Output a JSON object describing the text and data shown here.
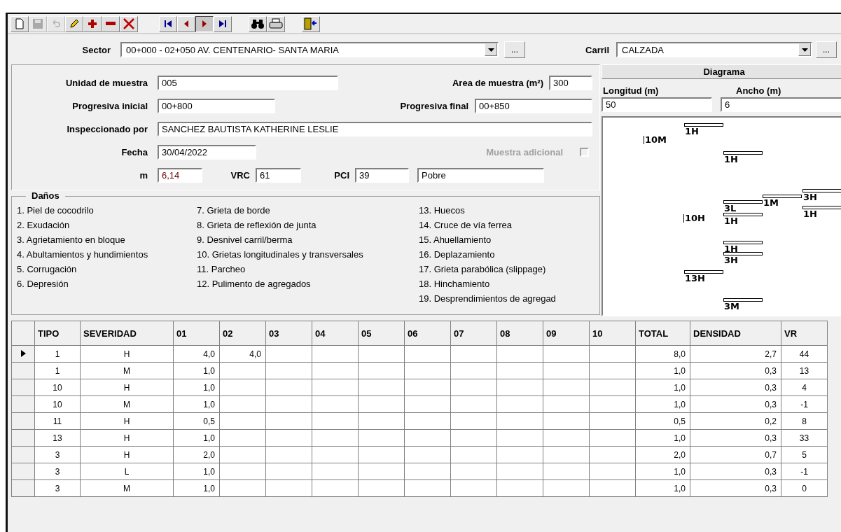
{
  "toolbar": [
    {
      "disabled": false,
      "pressed": false
    },
    {
      "disabled": true,
      "pressed": false
    },
    {
      "disabled": true,
      "pressed": false
    },
    {
      "disabled": false,
      "pressed": false
    },
    {
      "disabled": false,
      "pressed": false
    },
    {
      "disabled": false,
      "pressed": false
    },
    {
      "disabled": false,
      "pressed": false
    },
    {
      "disabled": false,
      "pressed": false
    },
    {
      "disabled": false,
      "pressed": false
    },
    {
      "disabled": false,
      "pressed": true
    },
    {
      "disabled": false,
      "pressed": false
    },
    {
      "disabled": false,
      "pressed": false
    },
    {
      "disabled": false,
      "pressed": false
    },
    {
      "disabled": false,
      "pressed": false
    }
  ],
  "sector": {
    "label": "Sector",
    "value": "00+000 - 02+050  AV. CENTENARIO- SANTA MARIA",
    "more": "..."
  },
  "carril": {
    "label": "Carril",
    "value": "CALZADA",
    "more": "..."
  },
  "form": {
    "unidad": {
      "label": "Unidad de muestra",
      "value": "005"
    },
    "area": {
      "label": "Area de muestra (m²)",
      "value": "300"
    },
    "prog_inicial": {
      "label": "Progresiva inicial",
      "value": "00+800"
    },
    "prog_final": {
      "label": "Progresiva final",
      "value": "00+850"
    },
    "inspeccionado": {
      "label": "Inspeccionado por",
      "value": "SANCHEZ BAUTISTA KATHERINE LESLIE"
    },
    "fecha": {
      "label": "Fecha",
      "value": "30/04/2022"
    },
    "muestra_adicional": {
      "label": "Muestra adicional",
      "disabled": true,
      "checked": false
    },
    "m": {
      "label": "m",
      "value": "6,14"
    },
    "vrc": {
      "label": "VRC",
      "value": "61"
    },
    "pci": {
      "label": "PCI",
      "value": "39"
    },
    "condicion": {
      "value": "Pobre"
    }
  },
  "danos": {
    "title": "Daños",
    "columns": [
      [
        "1. Piel de cocodrilo",
        "2. Exudación",
        "3. Agrietamiento en bloque",
        "4. Abultamientos y hundimientos",
        "5. Corrugación",
        "6. Depresión"
      ],
      [
        "7. Grieta de borde",
        "8. Grieta de reflexión de junta",
        "9. Desnivel carril/berma",
        "10. Grietas longitudinales y transversales",
        "11. Parcheo",
        "12. Pulimento de agregados"
      ],
      [
        "13. Huecos",
        "14. Cruce de vía ferrea",
        "15. Ahuellamiento",
        "16. Deplazamiento",
        "17. Grieta parabólica (slippage)",
        "18. Hinchamiento",
        "19. Desprendimientos de agregad"
      ]
    ]
  },
  "diagrama": {
    "title": "Diagrama",
    "longitud": {
      "label": "Longitud (m)",
      "value": "50"
    },
    "ancho": {
      "label": "Ancho (m)",
      "value": "6"
    },
    "marks": [
      {
        "kind": "bar",
        "text": "1H"
      },
      {
        "kind": "tick",
        "text": "10M"
      },
      {
        "kind": "bar",
        "text": "1H"
      },
      {
        "kind": "bar",
        "text": "3H"
      },
      {
        "kind": "bar",
        "text": "1M"
      },
      {
        "kind": "bar",
        "text": "3L"
      },
      {
        "kind": "bar",
        "text": "1H"
      },
      {
        "kind": "tick",
        "text": "10H"
      },
      {
        "kind": "bar",
        "text": "1H"
      },
      {
        "kind": "bar",
        "text": "1H"
      },
      {
        "kind": "bar",
        "text": "3H"
      },
      {
        "kind": "bar",
        "text": "13H"
      },
      {
        "kind": "bar",
        "text": "3M"
      }
    ]
  },
  "table": {
    "columns": [
      "TIPO",
      "SEVERIDAD",
      "01",
      "02",
      "03",
      "04",
      "05",
      "06",
      "07",
      "08",
      "09",
      "10",
      "TOTAL",
      "DENSIDAD",
      "VR"
    ],
    "rows": [
      {
        "selected": true,
        "cells": [
          "1",
          "H",
          "4,0",
          "4,0",
          "",
          "",
          "",
          "",
          "",
          "",
          "",
          "",
          "8,0",
          "2,7",
          "44"
        ]
      },
      {
        "selected": false,
        "cells": [
          "1",
          "M",
          "1,0",
          "",
          "",
          "",
          "",
          "",
          "",
          "",
          "",
          "",
          "1,0",
          "0,3",
          "13"
        ]
      },
      {
        "selected": false,
        "cells": [
          "10",
          "H",
          "1,0",
          "",
          "",
          "",
          "",
          "",
          "",
          "",
          "",
          "",
          "1,0",
          "0,3",
          "4"
        ]
      },
      {
        "selected": false,
        "cells": [
          "10",
          "M",
          "1,0",
          "",
          "",
          "",
          "",
          "",
          "",
          "",
          "",
          "",
          "1,0",
          "0,3",
          "-1"
        ]
      },
      {
        "selected": false,
        "cells": [
          "11",
          "H",
          "0,5",
          "",
          "",
          "",
          "",
          "",
          "",
          "",
          "",
          "",
          "0,5",
          "0,2",
          "8"
        ]
      },
      {
        "selected": false,
        "cells": [
          "13",
          "H",
          "1,0",
          "",
          "",
          "",
          "",
          "",
          "",
          "",
          "",
          "",
          "1,0",
          "0,3",
          "33"
        ]
      },
      {
        "selected": false,
        "cells": [
          "3",
          "H",
          "2,0",
          "",
          "",
          "",
          "",
          "",
          "",
          "",
          "",
          "",
          "2,0",
          "0,7",
          "5"
        ]
      },
      {
        "selected": false,
        "cells": [
          "3",
          "L",
          "1,0",
          "",
          "",
          "",
          "",
          "",
          "",
          "",
          "",
          "",
          "1,0",
          "0,3",
          "-1"
        ]
      },
      {
        "selected": false,
        "cells": [
          "3",
          "M",
          "1,0",
          "",
          "",
          "",
          "",
          "",
          "",
          "",
          "",
          "",
          "1,0",
          "0,3",
          "0"
        ]
      }
    ]
  }
}
